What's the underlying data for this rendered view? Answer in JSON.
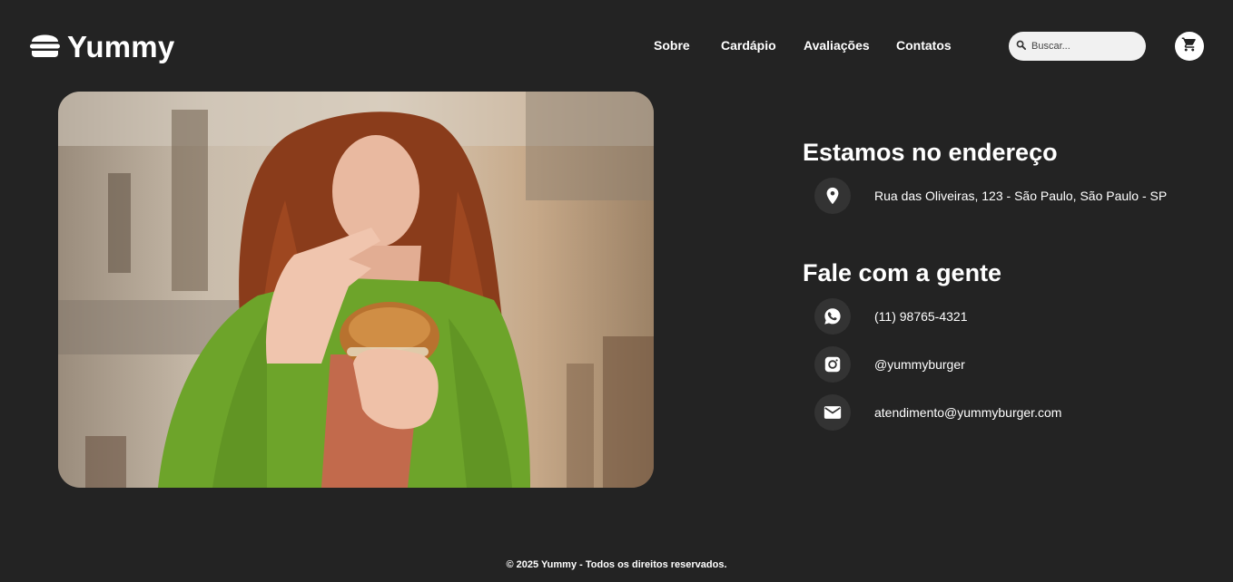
{
  "header": {
    "brand": "Yummy",
    "brand_icon": "burger-icon",
    "nav": [
      "Sobre",
      "Cardápio",
      "Avaliações",
      "Contatos"
    ],
    "search_placeholder": "Buscar...",
    "search_icon": "search-icon",
    "cart_icon": "cart-icon"
  },
  "address_section": {
    "title": "Estamos no endereço",
    "icon": "location-pin-icon",
    "address": "Rua das Oliveiras, 123 - São Paulo, São Paulo - SP"
  },
  "contact_section": {
    "title": "Fale com a gente",
    "items": [
      {
        "icon": "whatsapp-icon",
        "text": "(11) 98765-4321"
      },
      {
        "icon": "instagram-icon",
        "text": "@yummyburger"
      },
      {
        "icon": "mail-icon",
        "text": "atendimento@yummyburger.com"
      }
    ]
  },
  "footer": {
    "text": "© 2025 Yummy - Todos os direitos reservados."
  },
  "colors": {
    "background": "#232323",
    "icon_circle": "#333333",
    "text": "#ffffff",
    "search_bg": "#f1f1f1"
  }
}
